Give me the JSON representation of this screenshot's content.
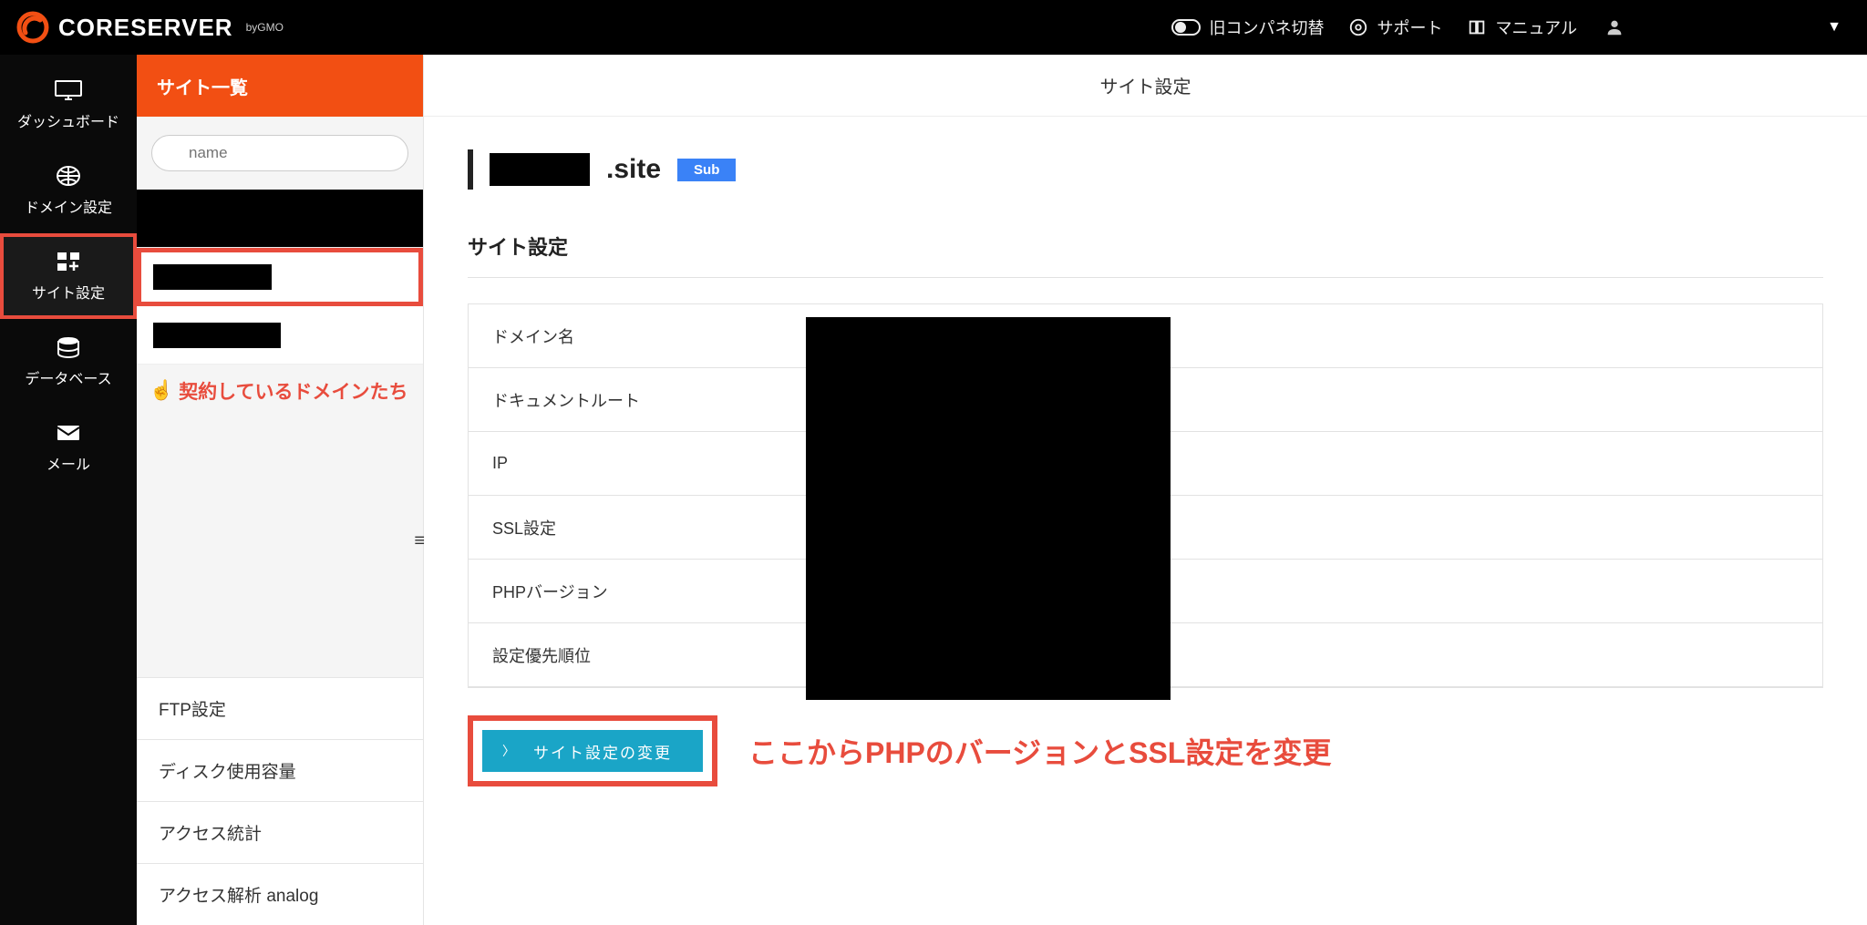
{
  "brand": {
    "name": "CORESERVER",
    "sub": "byGMO"
  },
  "header": {
    "old_panel_toggle": "旧コンパネ切替",
    "support": "サポート",
    "manual": "マニュアル"
  },
  "nav": {
    "dashboard": "ダッシュボード",
    "domain": "ドメイン設定",
    "site": "サイト設定",
    "database": "データベース",
    "mail": "メール"
  },
  "sidebar": {
    "title": "サイト一覧",
    "filter_placeholder": "name",
    "annotation": "契約しているドメインたち",
    "bottom": {
      "ftp": "FTP設定",
      "disk": "ディスク使用容量",
      "stats": "アクセス統計",
      "analog": "アクセス解析 analog"
    }
  },
  "main": {
    "page_title": "サイト設定",
    "domain_suffix": ".site",
    "sub_badge": "Sub",
    "section_title": "サイト設定",
    "rows": {
      "domain_name": "ドメイン名",
      "document_root": "ドキュメントルート",
      "ip": "IP",
      "ssl": "SSL設定",
      "php": "PHPバージョン",
      "priority": "設定優先順位"
    },
    "action_button": "サイト設定の変更",
    "annotation": "ここからPHPのバージョンとSSL設定を変更"
  }
}
